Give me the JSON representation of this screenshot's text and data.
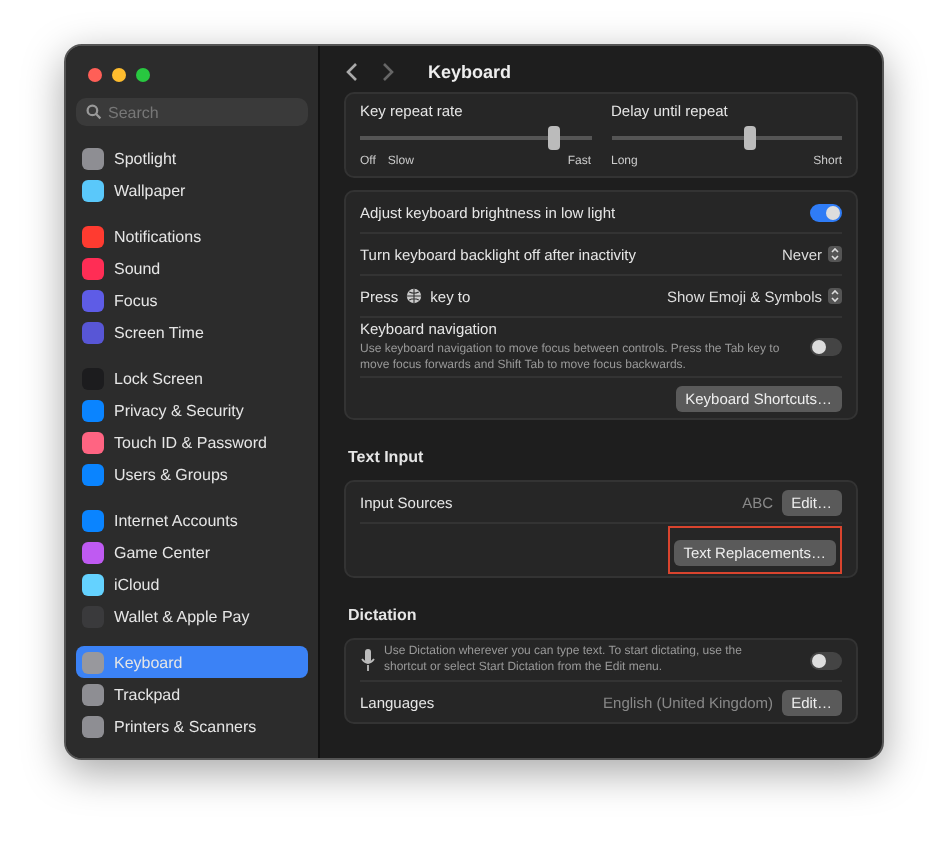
{
  "sidebar": {
    "search": {
      "placeholder": "Search"
    },
    "groups": [
      [
        {
          "label": "Spotlight",
          "color": "#8e8e93",
          "selected": false
        },
        {
          "label": "Wallpaper",
          "color": "#5ac8fa",
          "selected": false
        }
      ],
      [
        {
          "label": "Notifications",
          "color": "#ff3b30",
          "selected": false
        },
        {
          "label": "Sound",
          "color": "#ff2d55",
          "selected": false
        },
        {
          "label": "Focus",
          "color": "#5e5ce6",
          "selected": false
        },
        {
          "label": "Screen Time",
          "color": "#5856d6",
          "selected": false
        }
      ],
      [
        {
          "label": "Lock Screen",
          "color": "#1c1c1e",
          "selected": false
        },
        {
          "label": "Privacy & Security",
          "color": "#0a84ff",
          "selected": false
        },
        {
          "label": "Touch ID & Password",
          "color": "#ff6482",
          "selected": false
        },
        {
          "label": "Users & Groups",
          "color": "#0a84ff",
          "selected": false
        }
      ],
      [
        {
          "label": "Internet Accounts",
          "color": "#0a84ff",
          "selected": false
        },
        {
          "label": "Game Center",
          "color": "#bf5af2",
          "selected": false
        },
        {
          "label": "iCloud",
          "color": "#64d2ff",
          "selected": false
        },
        {
          "label": "Wallet & Apple Pay",
          "color": "#3a3a3c",
          "selected": false
        }
      ],
      [
        {
          "label": "Keyboard",
          "color": "#98989d",
          "selected": true
        },
        {
          "label": "Trackpad",
          "color": "#8e8e93",
          "selected": false
        },
        {
          "label": "Printers & Scanners",
          "color": "#8e8e93",
          "selected": false
        }
      ]
    ]
  },
  "title": "Keyboard",
  "sliders": [
    {
      "label": "Key repeat rate",
      "level": 0.84,
      "marks": [
        "Off",
        "Slow",
        "Fast"
      ]
    },
    {
      "label": "Delay until repeat",
      "level": 0.6,
      "marks": [
        "Long",
        "Short"
      ]
    }
  ],
  "keyboard_settings": [
    {
      "kind": "toggle",
      "label": "Adjust keyboard brightness in low light",
      "on": true
    },
    {
      "kind": "popup",
      "label": "Turn keyboard backlight off after inactivity",
      "value": "Never"
    },
    {
      "kind": "globe-popup",
      "label_before": "Press",
      "label_after": "key to",
      "value": "Show Emoji & Symbols"
    },
    {
      "kind": "toggle",
      "label": "Keyboard navigation",
      "description": "Use keyboard navigation to move focus between controls. Press the Tab key to move focus forwards and Shift Tab to move focus backwards.",
      "on": false
    },
    {
      "kind": "button",
      "button": "Keyboard Shortcuts…"
    }
  ],
  "text_input": {
    "heading": "Text Input",
    "label": "Input Sources",
    "value": "ABC",
    "edit": "Edit…",
    "button": "Text Replacements…",
    "highlighted": true
  },
  "dictation": {
    "heading": "Dictation",
    "description": "Use Dictation wherever you can type text. To start dictating, use the shortcut or select Start Dictation from the Edit menu.",
    "on": false,
    "languages_label": "Languages",
    "languages_value": "English (United Kingdom)",
    "edit": "Edit…"
  }
}
